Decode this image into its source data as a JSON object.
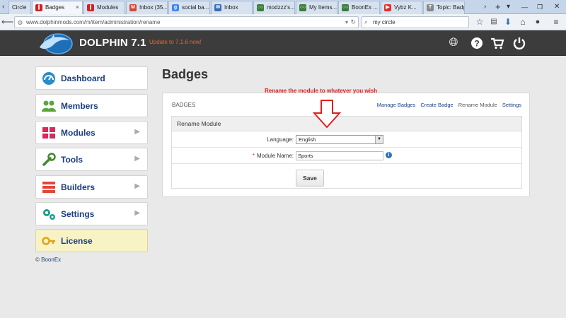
{
  "browser": {
    "tabs": [
      {
        "label": "Circle",
        "icon": "circle-favicon",
        "color": "#888888"
      },
      {
        "label": "Badges",
        "icon": "dolphin-favicon",
        "color": "#cc2222",
        "active": true
      },
      {
        "label": "Modules",
        "icon": "dolphin-favicon",
        "color": "#cc2222"
      },
      {
        "label": "Inbox (35...",
        "icon": "gmail-icon",
        "color": "#d44638"
      },
      {
        "label": "social ba...",
        "icon": "google-icon",
        "color": "#4285f4"
      },
      {
        "label": "Inbox",
        "icon": "mail-icon",
        "color": "#3a6bb5"
      },
      {
        "label": "modzzz's...",
        "icon": "modzzz-icon",
        "color": "#3a7a3a"
      },
      {
        "label": "My Items...",
        "icon": "modzzz-icon",
        "color": "#3a7a3a"
      },
      {
        "label": "BoonEx ...",
        "icon": "modzzz-icon",
        "color": "#3a7a3a"
      },
      {
        "label": "Vybz K...",
        "icon": "youtube-icon",
        "color": "#e52d27"
      },
      {
        "label": "Topic: Badge ...",
        "icon": "topic-icon",
        "color": "#888888"
      }
    ],
    "tab_close": "×",
    "new_tab": "+",
    "dropdown": "▾",
    "url": "www.dolphinmods.com/m/item/administration/rename",
    "search_value": "my circle"
  },
  "header": {
    "brand": "DOLPHIN 7.1",
    "update_text": "Update to 7.1.6 now!",
    "icons": [
      "globe-icon",
      "help-icon",
      "cart-icon",
      "power-icon"
    ]
  },
  "sidebar": {
    "items": [
      {
        "label": "Dashboard",
        "icon": "dashboard-icon",
        "color": "#2a8cc7",
        "arrow": false
      },
      {
        "label": "Members",
        "icon": "members-icon",
        "color": "#5aa63d",
        "arrow": false
      },
      {
        "label": "Modules",
        "icon": "modules-icon",
        "color": "#d9295b",
        "arrow": true
      },
      {
        "label": "Tools",
        "icon": "tools-icon",
        "color": "#3f8c2c",
        "arrow": true
      },
      {
        "label": "Builders",
        "icon": "builders-icon",
        "color": "#e2463a",
        "arrow": true
      },
      {
        "label": "Settings",
        "icon": "settings-icon",
        "color": "#1c9e8f",
        "arrow": true
      },
      {
        "label": "License",
        "icon": "license-icon",
        "color": "#e3a21a",
        "arrow": false
      }
    ],
    "copyright_symbol": "©",
    "copyright_link": "BoonEx"
  },
  "main": {
    "page_title": "Badges",
    "annotation": "Rename the module to whatever you wish",
    "panel": {
      "title": "BADGES",
      "tabs": [
        {
          "label": "Manage Badges",
          "current": false
        },
        {
          "label": "Create Badge",
          "current": false
        },
        {
          "label": "Rename Module",
          "current": true
        },
        {
          "label": "Settings",
          "current": false
        }
      ],
      "form": {
        "heading": "Rename Module",
        "language_label": "Language:",
        "language_value": "English",
        "module_name_required": "*",
        "module_name_label": "Module Name:",
        "module_name_value": "Sports",
        "save_label": "Save"
      }
    }
  }
}
